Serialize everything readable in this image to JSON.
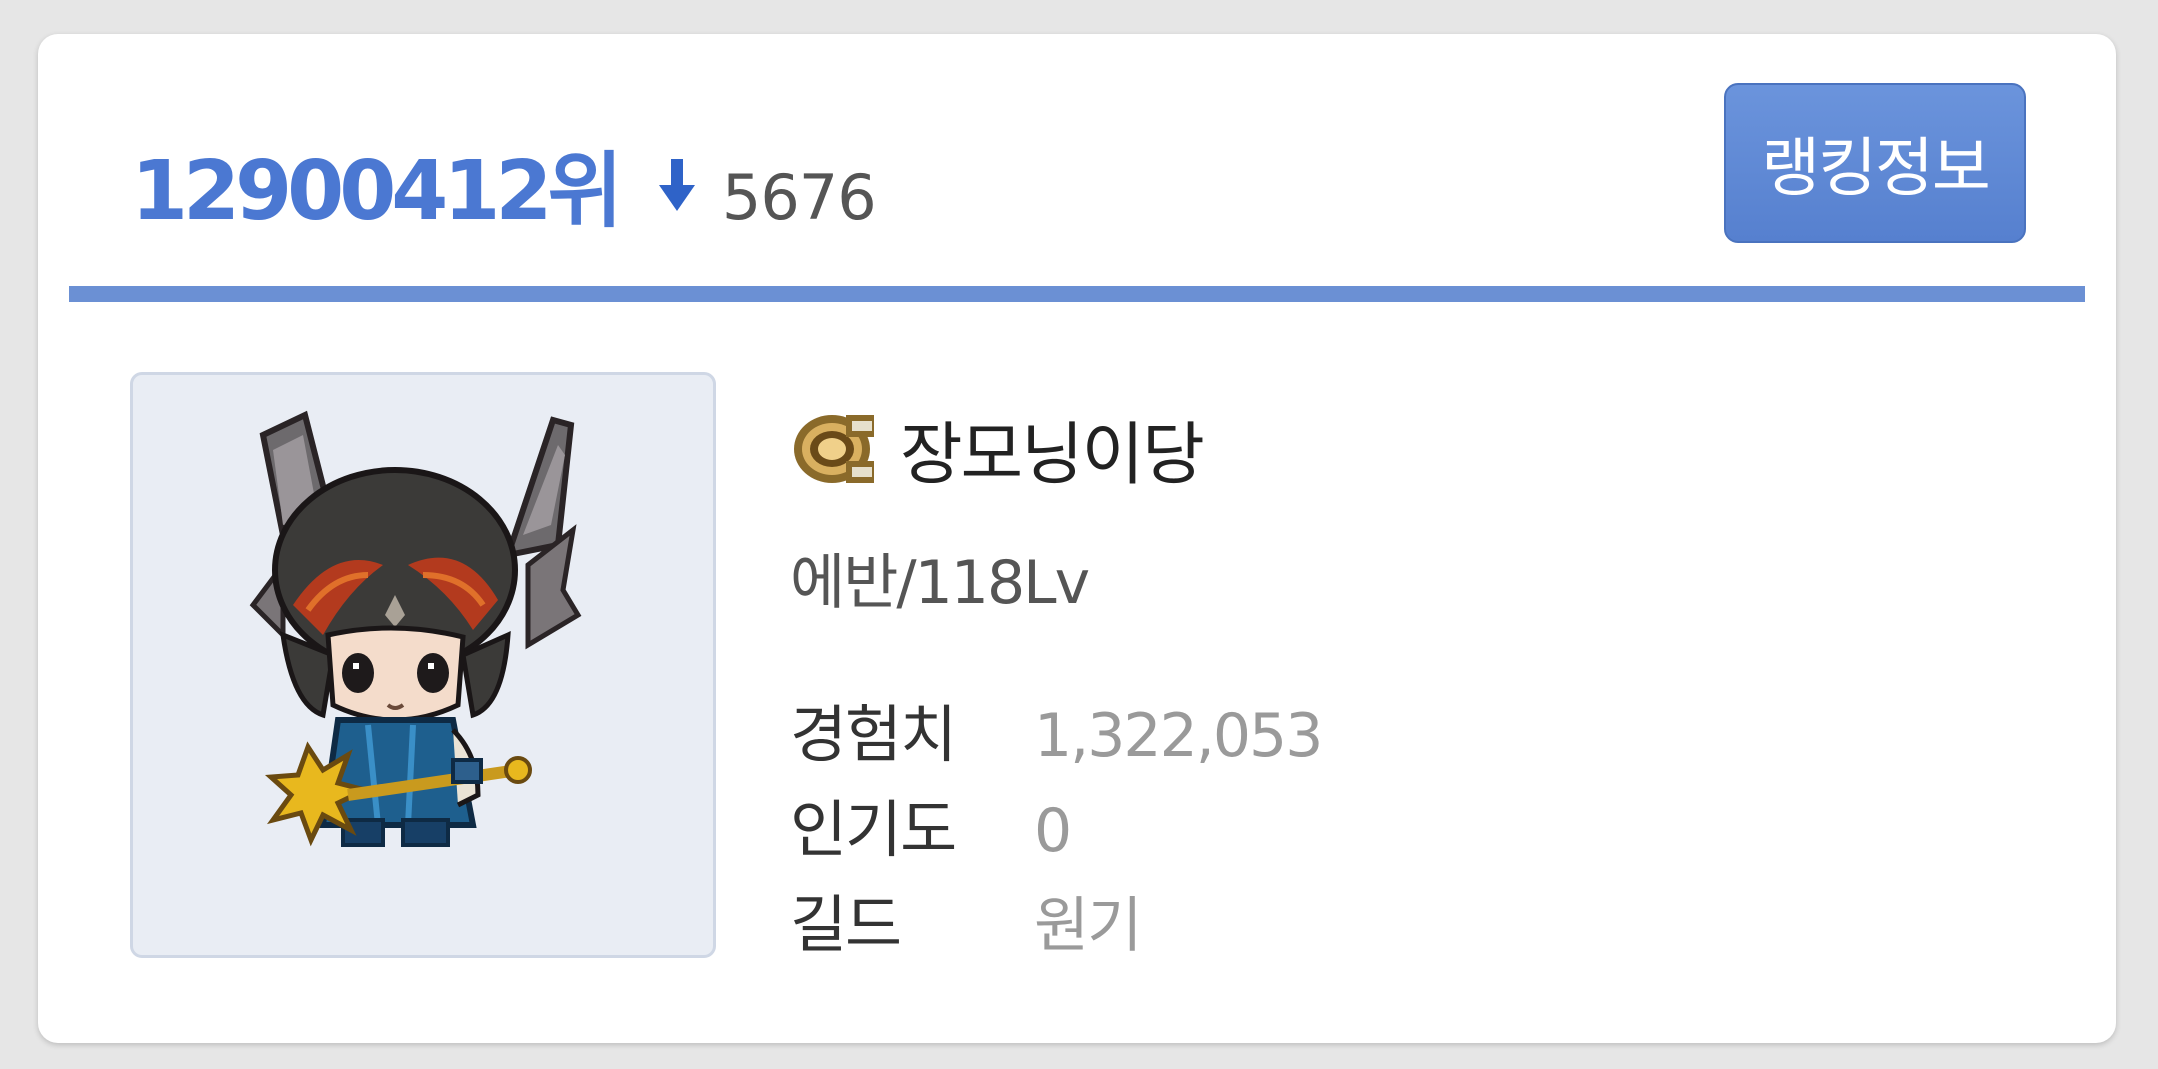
{
  "header": {
    "rank": "12900412위",
    "rank_change": "5676",
    "rank_change_direction": "down",
    "ranking_button_label": "랭킹정보"
  },
  "character": {
    "name": "장모닝이당",
    "job_level": "에반/118Lv",
    "job_icon": "evan-job-emblem-icon",
    "avatar": "character-avatar"
  },
  "stats": {
    "exp_label": "경험치",
    "exp_value": "1,322,053",
    "fame_label": "인기도",
    "fame_value": "0",
    "guild_label": "길드",
    "guild_value": "원기"
  },
  "colors": {
    "accent": "#4b78d2",
    "divider": "#6b90d4",
    "button": "#5f8ad6",
    "background": "#e6e6e6",
    "avatar_bg": "#e9edf4"
  }
}
